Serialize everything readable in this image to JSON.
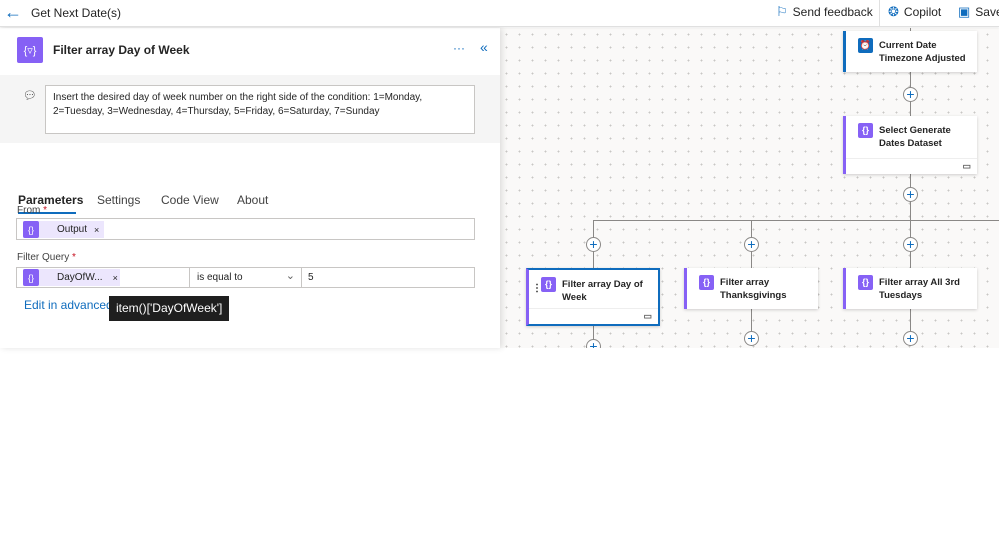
{
  "header": {
    "title": "Get Next Date(s)",
    "send_feedback": "Send feedback",
    "copilot": "Copilot",
    "save": "Save"
  },
  "panel": {
    "title": "Filter array Day of Week",
    "more": "···",
    "note": "Insert the desired day of week number on the right side of the condition: 1=Monday, 2=Tuesday, 3=Wednesday, 4=Thursday, 5=Friday, 6=Saturday, 7=Sunday",
    "tabs": [
      {
        "label": "Parameters",
        "active": true
      },
      {
        "label": "Settings"
      },
      {
        "label": "Code View"
      },
      {
        "label": "About"
      }
    ],
    "from": {
      "label": "From",
      "required": "*",
      "token": "Output"
    },
    "filter": {
      "label": "Filter Query",
      "required": "*",
      "token": "DayOfW...",
      "operator": "is equal to",
      "value": "5"
    },
    "edit_advanced": "Edit in advanced",
    "tooltip": "item()['DayOfWeek']"
  },
  "flow": {
    "nodes": [
      {
        "title": "Current Date Timezone Adjusted",
        "icon": "clock-icon",
        "color": "#0f6cbd"
      },
      {
        "title": "Select Generate Dates Dataset",
        "icon": "data-operation-icon",
        "color": "#8661f5"
      },
      {
        "title": "Filter array Day of Week",
        "icon": "data-operation-icon",
        "color": "#8661f5",
        "selected": true
      },
      {
        "title": "Filter array Thanksgivings",
        "icon": "data-operation-icon",
        "color": "#8661f5"
      },
      {
        "title": "Filter array All 3rd Tuesdays",
        "icon": "data-operation-icon",
        "color": "#8661f5"
      }
    ]
  },
  "colors": {
    "accent": "#0f6cbd",
    "data_op": "#8661f5",
    "tooltip_bg": "#1f1f1f"
  }
}
